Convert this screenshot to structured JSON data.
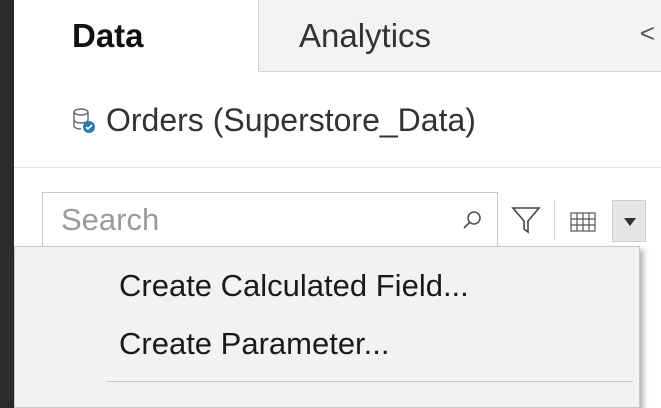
{
  "tabs": {
    "data_label": "Data",
    "analytics_label": "Analytics",
    "collapse_glyph": "<"
  },
  "source": {
    "label": "Orders (Superstore_Data)",
    "icon": "database-connection-icon"
  },
  "search": {
    "placeholder": "Search",
    "value": ""
  },
  "toolbar": {
    "filter_icon": "filter-icon",
    "view_icon": "list-view-icon",
    "dropdown_icon": "dropdown-arrow-icon"
  },
  "menu": {
    "items": [
      {
        "label": "Create Calculated Field..."
      },
      {
        "label": "Create Parameter..."
      }
    ]
  },
  "colors": {
    "background": "#2b2b2b",
    "panel": "#ffffff",
    "menu": "#f2f2f2",
    "accent": "#2a7ab0"
  }
}
